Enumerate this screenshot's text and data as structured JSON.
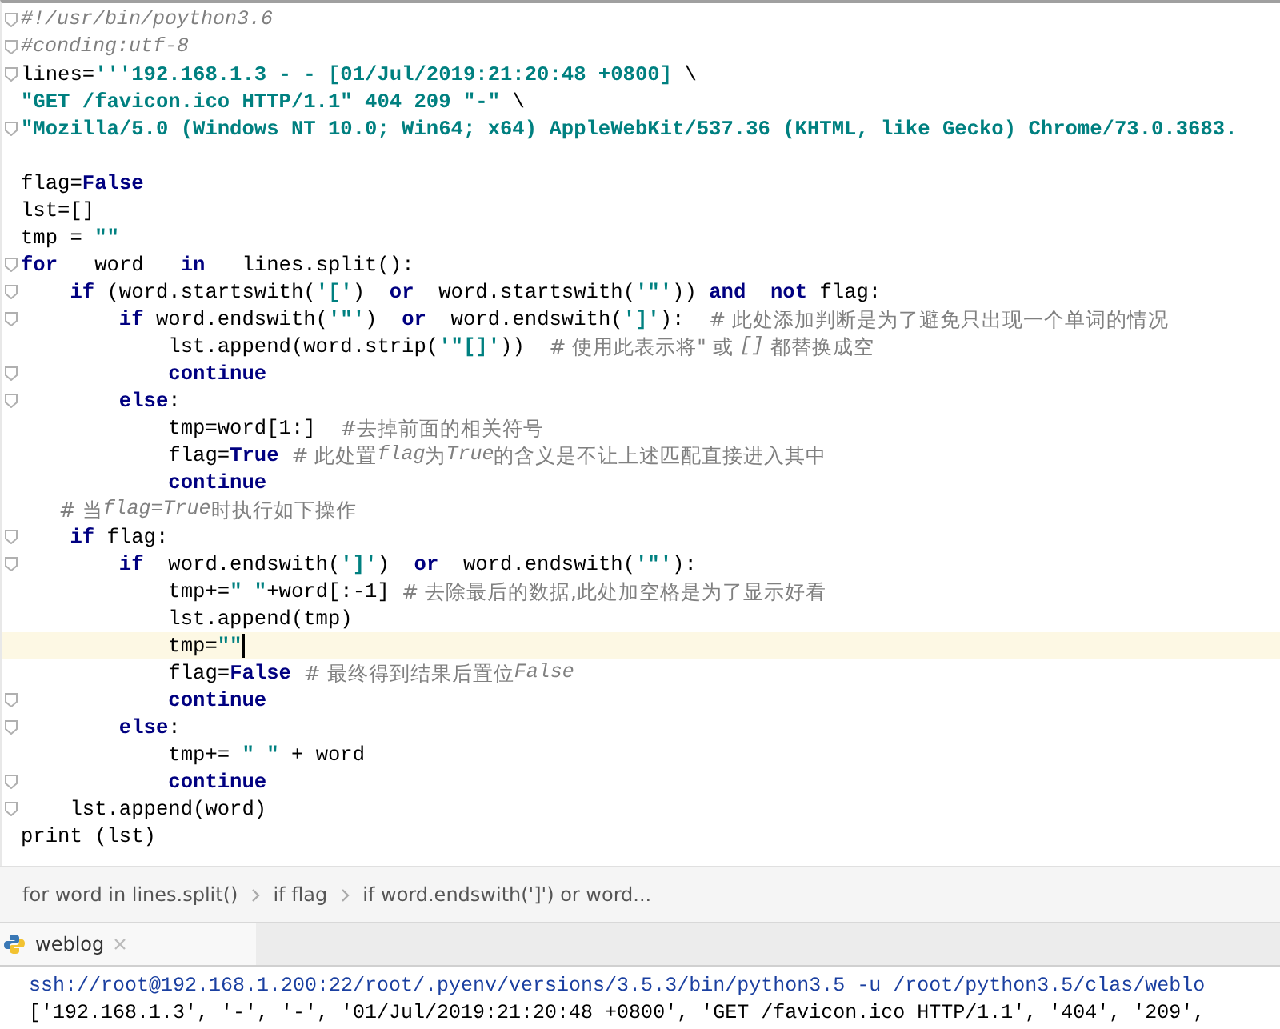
{
  "editor": {
    "lines": [
      {
        "fold": true,
        "tokens": [
          {
            "kind": "comment-italic",
            "text": "#!/usr/bin/poython3.6"
          }
        ]
      },
      {
        "fold": true,
        "tokens": [
          {
            "kind": "comment-italic",
            "text": "#conding:utf-8"
          }
        ]
      },
      {
        "fold": true,
        "tokens": [
          {
            "kind": "plain",
            "text": "lines="
          },
          {
            "kind": "str",
            "text": "'''192.168.1.3 - - [01/Jul/2019:21:20:48 +0800] "
          },
          {
            "kind": "plain",
            "text": "\\"
          }
        ]
      },
      {
        "fold": false,
        "tokens": [
          {
            "kind": "str",
            "text": "\"GET /favicon.ico HTTP/1.1\" 404 209 \"-\" "
          },
          {
            "kind": "plain",
            "text": "\\"
          }
        ]
      },
      {
        "fold": true,
        "tokens": [
          {
            "kind": "str",
            "text": "\"Mozilla/5.0 (Windows NT 10.0; Win64; x64) AppleWebKit/537.36 (KHTML, like Gecko) Chrome/73.0.3683."
          }
        ]
      },
      {
        "fold": false
      },
      {
        "fold": false,
        "tokens": [
          {
            "kind": "plain",
            "text": "flag="
          },
          {
            "kind": "kw",
            "text": "False"
          }
        ]
      },
      {
        "fold": false,
        "tokens": [
          {
            "kind": "plain",
            "text": "lst=[]"
          }
        ]
      },
      {
        "fold": false,
        "tokens": [
          {
            "kind": "plain",
            "text": "tmp = "
          },
          {
            "kind": "str",
            "text": "\"\""
          }
        ]
      },
      {
        "fold": true,
        "tokens": [
          {
            "kind": "kw",
            "text": "for"
          },
          {
            "kind": "plain",
            "text": "   word   "
          },
          {
            "kind": "kw",
            "text": "in"
          },
          {
            "kind": "plain",
            "text": "   lines.split():"
          }
        ]
      },
      {
        "fold": true,
        "tokens": [
          {
            "kind": "kw",
            "text": "    if"
          },
          {
            "kind": "plain",
            "text": " (word.startswith("
          },
          {
            "kind": "str",
            "text": "'['"
          },
          {
            "kind": "plain",
            "text": ")  "
          },
          {
            "kind": "kw",
            "text": "or"
          },
          {
            "kind": "plain",
            "text": "  word.startswith("
          },
          {
            "kind": "str",
            "text": "'\"'"
          },
          {
            "kind": "plain",
            "text": ")) "
          },
          {
            "kind": "kw",
            "text": "and  not"
          },
          {
            "kind": "plain",
            "text": " flag:"
          }
        ]
      },
      {
        "fold": true,
        "tokens": [
          {
            "kind": "kw",
            "text": "        if"
          },
          {
            "kind": "plain",
            "text": " word.endswith("
          },
          {
            "kind": "str",
            "text": "'\"'"
          },
          {
            "kind": "plain",
            "text": ")  "
          },
          {
            "kind": "kw",
            "text": "or"
          },
          {
            "kind": "plain",
            "text": "  word.endswith("
          },
          {
            "kind": "str",
            "text": "']'"
          },
          {
            "kind": "plain",
            "text": "):  "
          },
          {
            "kind": "comment",
            "text": "# 此处添加判断是为了避免只出现一个单词的情况"
          }
        ]
      },
      {
        "fold": false,
        "tokens": [
          {
            "kind": "plain",
            "text": "            lst.append(word.strip("
          },
          {
            "kind": "str",
            "text": "'\"[]'"
          },
          {
            "kind": "plain",
            "text": "))  "
          },
          {
            "kind": "comment",
            "text": "# 使用此表示将\" 或 "
          },
          {
            "kind": "comment-em",
            "text": "[]"
          },
          {
            "kind": "comment",
            "text": " 都替换成空"
          }
        ]
      },
      {
        "fold": true,
        "tokens": [
          {
            "kind": "kw",
            "text": "            continue"
          }
        ]
      },
      {
        "fold": true,
        "tokens": [
          {
            "kind": "kw",
            "text": "        else"
          },
          {
            "kind": "plain",
            "text": ":"
          }
        ]
      },
      {
        "fold": false,
        "tokens": [
          {
            "kind": "plain",
            "text": "            tmp=word[1:]  "
          },
          {
            "kind": "comment",
            "text": "#去掉前面的相关符号"
          }
        ]
      },
      {
        "fold": false,
        "tokens": [
          {
            "kind": "plain",
            "text": "            flag="
          },
          {
            "kind": "kw",
            "text": "True"
          },
          {
            "kind": "comment",
            "text": "  # 此处置"
          },
          {
            "kind": "comment-em",
            "text": "flag"
          },
          {
            "kind": "comment",
            "text": "为"
          },
          {
            "kind": "comment-em",
            "text": "True"
          },
          {
            "kind": "comment",
            "text": "的含义是不让上述匹配直接进入其中"
          }
        ]
      },
      {
        "fold": false,
        "tokens": [
          {
            "kind": "kw",
            "text": "            continue"
          }
        ]
      },
      {
        "fold": false,
        "tokens": [
          {
            "kind": "comment",
            "text": "      # 当"
          },
          {
            "kind": "comment-em",
            "text": "flag=True"
          },
          {
            "kind": "comment",
            "text": "时执行如下操作"
          }
        ]
      },
      {
        "fold": true,
        "tokens": [
          {
            "kind": "kw",
            "text": "    if"
          },
          {
            "kind": "plain",
            "text": " flag:"
          }
        ]
      },
      {
        "fold": true,
        "tokens": [
          {
            "kind": "kw",
            "text": "        if"
          },
          {
            "kind": "plain",
            "text": "  word.endswith("
          },
          {
            "kind": "str",
            "text": "']'"
          },
          {
            "kind": "plain",
            "text": ")  "
          },
          {
            "kind": "kw",
            "text": "or"
          },
          {
            "kind": "plain",
            "text": "  word.endswith("
          },
          {
            "kind": "str",
            "text": "'\"'"
          },
          {
            "kind": "plain",
            "text": "):"
          }
        ]
      },
      {
        "fold": false,
        "tokens": [
          {
            "kind": "plain",
            "text": "            tmp+="
          },
          {
            "kind": "str",
            "text": "\" \""
          },
          {
            "kind": "plain",
            "text": "+word[:-1] "
          },
          {
            "kind": "comment",
            "text": "# 去除最后的数据,此处加空格是为了显示好看"
          }
        ]
      },
      {
        "fold": false,
        "tokens": [
          {
            "kind": "plain",
            "text": "            lst.append(tmp)"
          }
        ]
      },
      {
        "fold": false,
        "current": true,
        "tokens": [
          {
            "kind": "plain",
            "text": "            tmp="
          },
          {
            "kind": "str",
            "text": "\"\""
          }
        ]
      },
      {
        "fold": false,
        "tokens": [
          {
            "kind": "plain",
            "text": "            flag="
          },
          {
            "kind": "kw",
            "text": "False"
          },
          {
            "kind": "comment",
            "text": "  # 最终得到结果后置位"
          },
          {
            "kind": "comment-em",
            "text": "False"
          }
        ]
      },
      {
        "fold": true,
        "tokens": [
          {
            "kind": "kw",
            "text": "            continue"
          }
        ]
      },
      {
        "fold": true,
        "tokens": [
          {
            "kind": "kw",
            "text": "        else"
          },
          {
            "kind": "plain",
            "text": ":"
          }
        ]
      },
      {
        "fold": false,
        "tokens": [
          {
            "kind": "plain",
            "text": "            tmp+= "
          },
          {
            "kind": "str",
            "text": "\" \""
          },
          {
            "kind": "plain",
            "text": " + word"
          }
        ]
      },
      {
        "fold": true,
        "tokens": [
          {
            "kind": "kw",
            "text": "            continue"
          }
        ]
      },
      {
        "fold": true,
        "tokens": [
          {
            "kind": "plain",
            "text": "    lst.append(word)"
          }
        ]
      },
      {
        "fold": false,
        "tokens": [
          {
            "kind": "plain",
            "text": "print (lst)"
          }
        ]
      }
    ]
  },
  "breadcrumbs": [
    "for word in lines.split()",
    "if flag",
    "if word.endswith(']')  or  word..."
  ],
  "tool_window": {
    "tabs": [
      {
        "label": "weblog",
        "selected": true
      }
    ],
    "console": [
      {
        "kind": "command",
        "text": "ssh://root@192.168.1.200:22/root/.pyenv/versions/3.5.3/bin/python3.5 -u /root/python3.5/clas/weblo"
      },
      {
        "kind": "output",
        "text": "['192.168.1.3', '-', '-', '01/Jul/2019:21:20:48 +0800', 'GET /favicon.ico HTTP/1.1', '404', '209',"
      }
    ]
  }
}
